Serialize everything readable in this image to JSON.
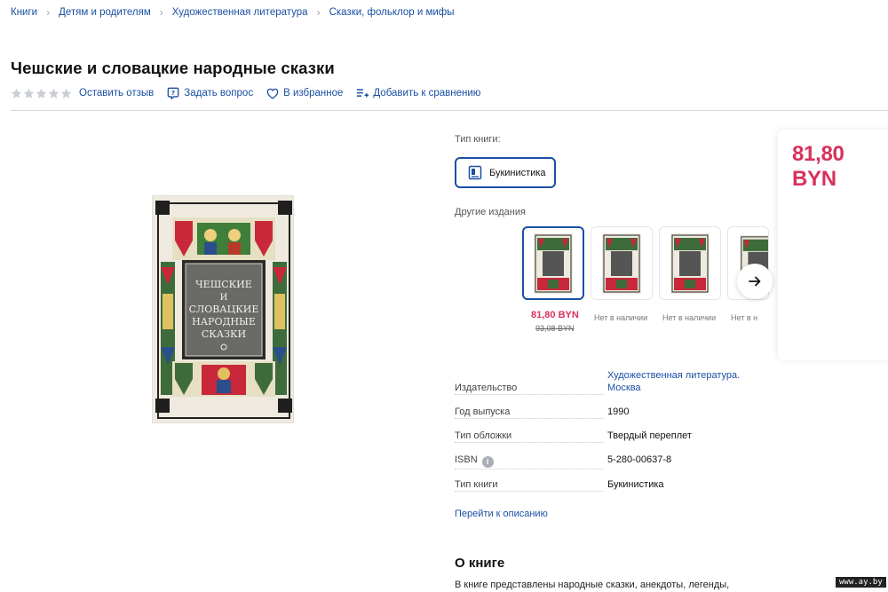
{
  "breadcrumbs": [
    "Книги",
    "Детям и родителям",
    "Художественная литература",
    "Сказки, фольклор и мифы"
  ],
  "title": "Чешские и словацкие народные сказки",
  "actions": {
    "review": "Оставить отзыв",
    "question": "Задать вопрос",
    "favorite": "В избранное",
    "compare": "Добавить к сравнению"
  },
  "rating": 0,
  "cover_text": [
    "ЧЕШСКИЕ",
    "И",
    "СЛОВАЦКИЕ",
    "НАРОДНЫЕ",
    "СКАЗКИ"
  ],
  "book_type": {
    "label": "Тип книги:",
    "value": "Букинистика"
  },
  "other_editions": {
    "label": "Другие издания",
    "items": [
      {
        "price": "81,80 BYN",
        "old_price": "93,08 BYN",
        "status": ""
      },
      {
        "price": "",
        "old_price": "",
        "status": "Нет в наличии"
      },
      {
        "price": "",
        "old_price": "",
        "status": "Нет в наличии"
      },
      {
        "price": "",
        "old_price": "",
        "status": "Нет в н"
      }
    ]
  },
  "price": "81,80 BYN",
  "specs": [
    {
      "label": "Издательство",
      "value": "Художественная литература. Москва",
      "link": true
    },
    {
      "label": "Год выпуска",
      "value": "1990"
    },
    {
      "label": "Тип обложки",
      "value": "Твердый переплет"
    },
    {
      "label": "ISBN",
      "value": "5-280-00637-8"
    },
    {
      "label": "Тип книги",
      "value": "Букинистика"
    }
  ],
  "info_icon": "i",
  "goto_description": "Перейти к описанию",
  "about": {
    "title": "О книге",
    "text": "В книге представлены народные сказки, анекдоты, легенды,"
  },
  "watermark": "www.ay.by",
  "colors": {
    "link": "#1a4fa3",
    "price": "#d8315b",
    "star": "#c9ced6"
  }
}
